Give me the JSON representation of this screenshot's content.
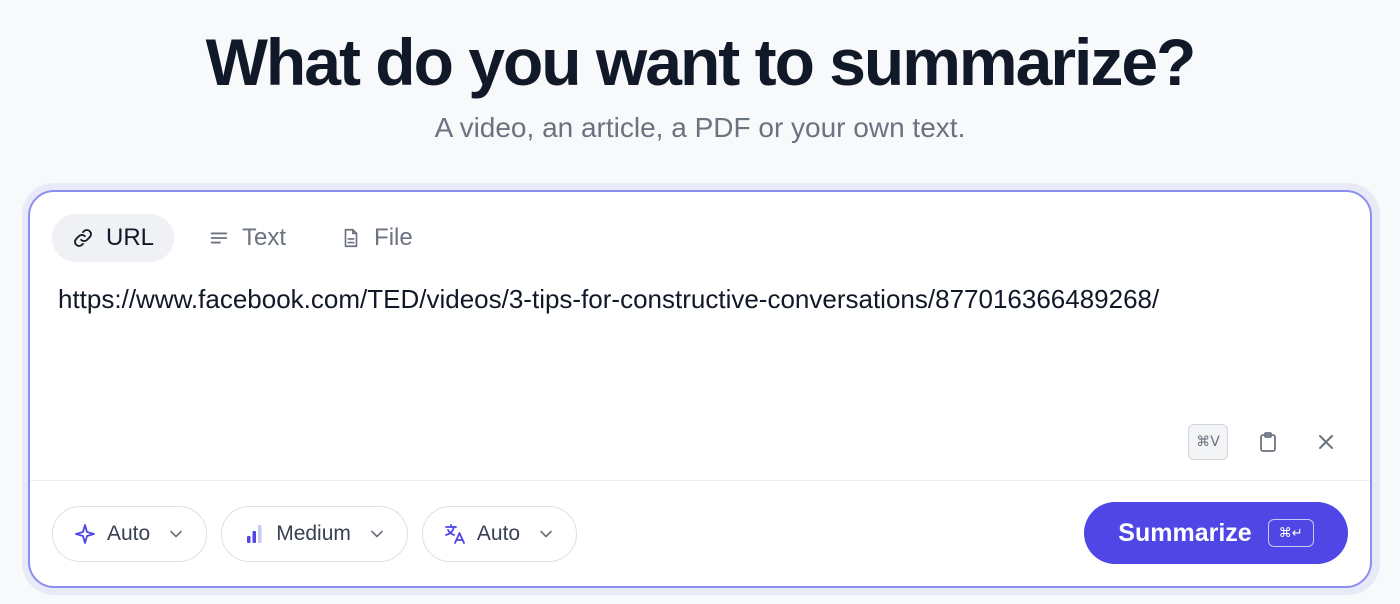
{
  "header": {
    "title": "What do you want to summarize?",
    "subtitle": "A video, an article, a PDF or your own text."
  },
  "tabs": [
    {
      "label": "URL",
      "icon": "link-icon",
      "active": true
    },
    {
      "label": "Text",
      "icon": "lines-icon",
      "active": false
    },
    {
      "label": "File",
      "icon": "file-icon",
      "active": false
    }
  ],
  "input": {
    "value": "https://www.facebook.com/TED/videos/3-tips-for-constructive-conversations/877016366489268/"
  },
  "tools": {
    "paste_shortcut": "⌘V",
    "clipboard_icon": "clipboard-icon",
    "clear_icon": "close-icon"
  },
  "controls": {
    "mode": {
      "label": "Auto",
      "icon": "sparkle-icon"
    },
    "length": {
      "label": "Medium",
      "icon": "bars-icon"
    },
    "language": {
      "label": "Auto",
      "icon": "translate-icon"
    }
  },
  "submit": {
    "label": "Summarize",
    "shortcut": "⌘↵"
  },
  "colors": {
    "accent": "#4f46e5",
    "border": "#8b8ef0",
    "text": "#111827",
    "muted": "#6b7280"
  }
}
